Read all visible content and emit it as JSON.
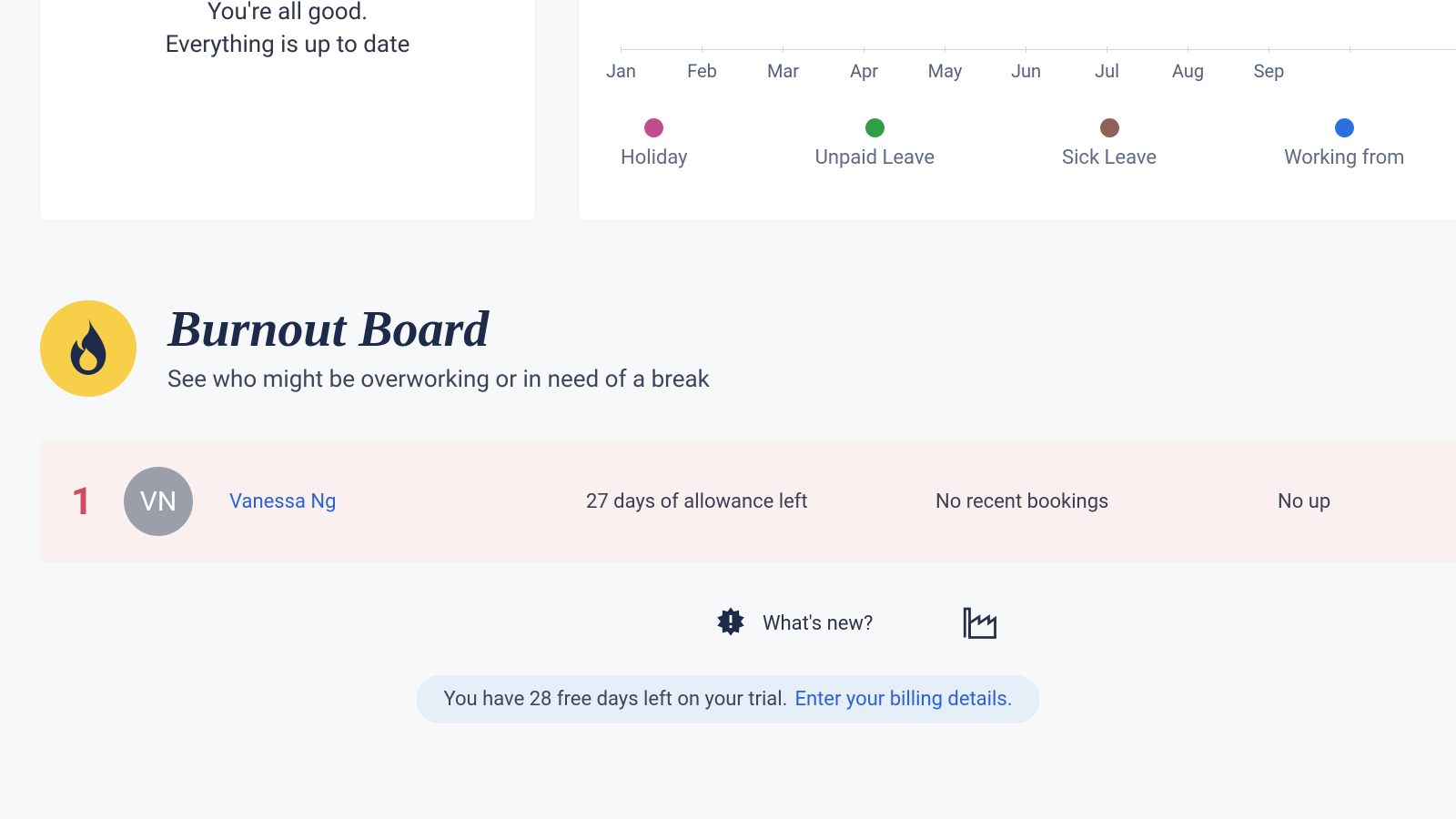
{
  "status_card": {
    "line1": "You're all good.",
    "line2": "Everything is up to date"
  },
  "timeline": {
    "months": [
      "Jan",
      "Feb",
      "Mar",
      "Apr",
      "May",
      "Jun",
      "Jul",
      "Aug",
      "Sep"
    ],
    "legend": [
      {
        "label": "Holiday",
        "color": "#c24d8e"
      },
      {
        "label": "Unpaid Leave",
        "color": "#2f9e44"
      },
      {
        "label": "Sick Leave",
        "color": "#8e615b"
      },
      {
        "label": "Working from",
        "color": "#2b6fe0"
      }
    ]
  },
  "burnout": {
    "title": "Burnout Board",
    "subtitle": "See who might be overworking or in need of a break",
    "rows": [
      {
        "rank": "1",
        "initials": "VN",
        "name": "Vanessa Ng",
        "allowance": "27 days of allowance left",
        "recent_bookings": "No recent bookings",
        "upcoming": "No up"
      }
    ]
  },
  "footer": {
    "whats_new": "What's new?"
  },
  "trial": {
    "message": "You have 28 free days left on your trial. ",
    "link_text": "Enter your billing details."
  }
}
